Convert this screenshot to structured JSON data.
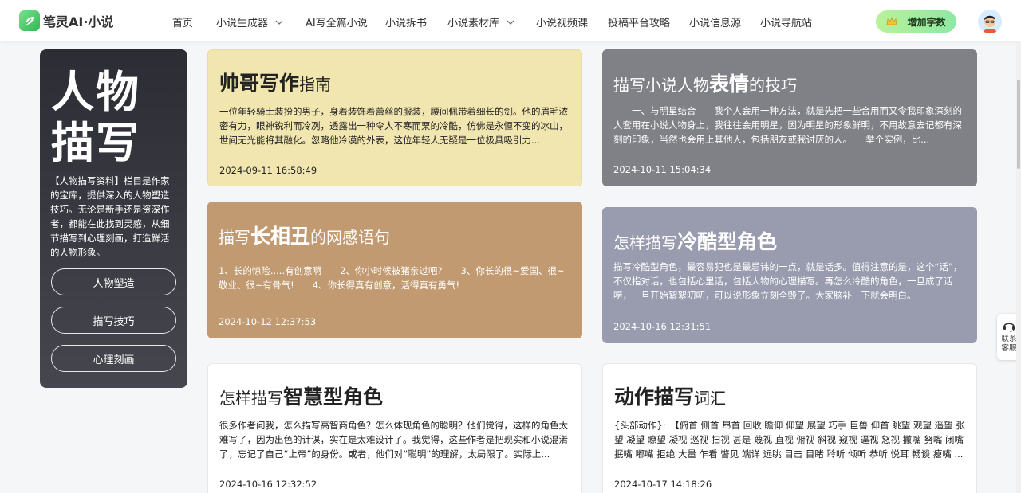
{
  "header": {
    "logo_text": "笔灵AI·小说",
    "nav": [
      {
        "label": "首页",
        "dropdown": false
      },
      {
        "label": "小说生成器",
        "dropdown": true
      },
      {
        "label": "AI写全篇小说",
        "dropdown": false
      },
      {
        "label": "小说拆书",
        "dropdown": false
      },
      {
        "label": "小说素材库",
        "dropdown": true
      },
      {
        "label": "小说视频课",
        "dropdown": false
      },
      {
        "label": "投稿平台攻略",
        "dropdown": false
      },
      {
        "label": "小说信息源",
        "dropdown": false
      },
      {
        "label": "小说导航站",
        "dropdown": false
      }
    ],
    "cta_label": "增加字数"
  },
  "sidebar": {
    "title_line1": "人物",
    "title_line2": "描写",
    "description": "【人物描写资料】栏目是作家的宝库，提供深入的人物塑造技巧。无论是新手还是资深作者，都能在此找到灵感，从细节描写到心理刻画，打造鲜活的人物形象。",
    "buttons": [
      "人物塑造",
      "描写技巧",
      "心理刻画"
    ]
  },
  "cards": [
    {
      "title_pre": "",
      "title_bold": "帅哥写作",
      "title_post": "指南",
      "body": "一位年轻骑士装扮的男子，身着装饰着蕾丝的服装，腰间佩带着细长的剑。他的眉毛浓密有力，眼神锐利而冷冽，透露出一种令人不寒而栗的冷酷，仿佛是永恒不变的冰山，世间无光能将其融化。忽略他冷漠的外表，这位年轻人无疑是一位极具吸引力...",
      "date": "2024-09-11 16:58:49",
      "bg": "#f2e6b0",
      "text_color": "#222222"
    },
    {
      "title_pre": "描写小说人物",
      "title_bold": "表情",
      "title_post": "的技巧",
      "body": "　　一、与明星结合　　我个人会用一种方法，就是先把一些合用而又令我印象深刻的人套用在小说人物身上，我往往会用明星，因为明星的形象鲜明，不用故意去记都有深刻的印象，当然也会用上其他人，包括朋友或我讨厌的人。　　举个实例，比...",
      "date": "2024-10-11 15:04:34",
      "bg": "#808087",
      "text_color": "#ffffff"
    },
    {
      "title_pre": "描写",
      "title_bold": "长相丑",
      "title_post": "的网感语句",
      "body": "1、长的惊险.....有创意啊　　2、你小时候被猪亲过吧?　　3、你长的很~爱国、很~敬业、很~有骨气!　　4、你长得真有创意，活得真有勇气!",
      "date": "2024-10-12 12:37:53",
      "bg": "#c19a71",
      "text_color": "#ffffff"
    },
    {
      "title_pre": "怎样描写",
      "title_bold": "冷酷型角色",
      "title_post": "",
      "body": "描写冷酷型角色，最容易犯也是最忌讳的一点，就是话多。值得注意的是，这个“话”，不仅指对话，也包括心里话，包括人物的心理描写。再怎么冷酷的角色，一旦成了话唠，一旦开始絮絮叨叨，可以说形象立刻全毁了。大家脑补一下就会明白。",
      "date": "2024-10-16 12:31:51",
      "bg": "#989cae",
      "text_color": "#ffffff"
    },
    {
      "title_pre": "怎样描写",
      "title_bold": "智慧型角色",
      "title_post": "",
      "body": "很多作者问我，怎么描写高智商角色？怎么体现角色的聪明？他们觉得，这样的角色太难写了，因为出色的计谋，实在是太难设计了。我觉得，这些作者是把现实和小说混淆了，忘记了自己“上帝”的身份。或者，他们对“聪明”的理解，太局限了。实际上...",
      "date": "2024-10-16 12:32:52",
      "bg": "#ffffff",
      "text_color": "#222222"
    },
    {
      "title_pre": "",
      "title_bold": "动作描写",
      "title_post": "词汇",
      "body": "{头部动作}:　【俯首 侧首 昂首 回收 瞻仰 仰望 展望 巧手 巨兽 仰首 眺望 观望 遥望 张望 凝望 瞭望 凝视 巡视 扫视 甚是 蔑视 直视 俯视 斜视 窥视 逼视 怒视 撇嘴 努嘴 闭嘴 抿嘴 嘟嘴 拒绝 大量 乍看 瞥见 端详 远眺 目击 目睹 聆听 倾听 恭听 悦耳 畅谈 瘪嘴 ...",
      "date": "2024-10-17 14:18:26",
      "bg": "#ffffff",
      "text_color": "#222222"
    }
  ],
  "help": {
    "label": "联系客服"
  }
}
